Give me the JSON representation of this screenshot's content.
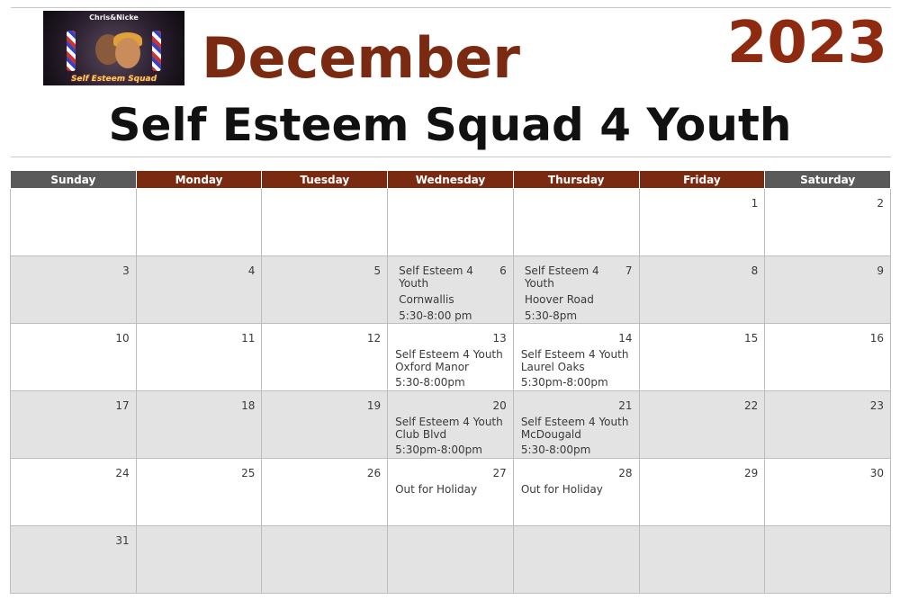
{
  "header": {
    "month": "December",
    "year": "2023",
    "title": "Self Esteem Squad 4 Youth",
    "logo_top_text": "Chris&Nicke",
    "logo_bottom_text": "Self Esteem Squad"
  },
  "weekdays": [
    "Sunday",
    "Monday",
    "Tuesday",
    "Wednesday",
    "Thursday",
    "Friday",
    "Saturday"
  ],
  "colors": {
    "accent": "#7b2a12",
    "weekend_header": "#5a5a5a",
    "row_shade": "#e3e3e3"
  },
  "weeks": [
    [
      {
        "day": ""
      },
      {
        "day": ""
      },
      {
        "day": ""
      },
      {
        "day": ""
      },
      {
        "day": ""
      },
      {
        "day": "1"
      },
      {
        "day": "2"
      }
    ],
    [
      {
        "day": "3"
      },
      {
        "day": "4"
      },
      {
        "day": "5"
      },
      {
        "day": "6",
        "title": "Self Esteem 4 Youth",
        "location": "Cornwallis",
        "time": "5:30-8:00 pm"
      },
      {
        "day": "7",
        "title": "Self Esteem 4 Youth",
        "location": "Hoover Road",
        "time": "5:30-8pm"
      },
      {
        "day": "8"
      },
      {
        "day": "9"
      }
    ],
    [
      {
        "day": "10"
      },
      {
        "day": "11"
      },
      {
        "day": "12"
      },
      {
        "day": "13",
        "title": "Self Esteem 4 Youth",
        "location": "Oxford Manor",
        "time": "5:30-8:00pm"
      },
      {
        "day": "14",
        "title": "Self Esteem 4 Youth",
        "location": "Laurel Oaks",
        "time": "5:30pm-8:00pm"
      },
      {
        "day": "15"
      },
      {
        "day": "16"
      }
    ],
    [
      {
        "day": "17"
      },
      {
        "day": "18"
      },
      {
        "day": "19"
      },
      {
        "day": "20",
        "title": "Self Esteem 4 Youth",
        "location": "Club Blvd",
        "time": "5:30pm-8:00pm"
      },
      {
        "day": "21",
        "title": "Self Esteem 4 Youth",
        "location": "McDougald",
        "time": "5:30-8:00pm"
      },
      {
        "day": "22"
      },
      {
        "day": "23"
      }
    ],
    [
      {
        "day": "24"
      },
      {
        "day": "25"
      },
      {
        "day": "26"
      },
      {
        "day": "27",
        "title": "Out for Holiday"
      },
      {
        "day": "28",
        "title": "Out for Holiday"
      },
      {
        "day": "29"
      },
      {
        "day": "30"
      }
    ],
    [
      {
        "day": "31"
      },
      {
        "day": ""
      },
      {
        "day": ""
      },
      {
        "day": ""
      },
      {
        "day": ""
      },
      {
        "day": ""
      },
      {
        "day": ""
      }
    ]
  ]
}
